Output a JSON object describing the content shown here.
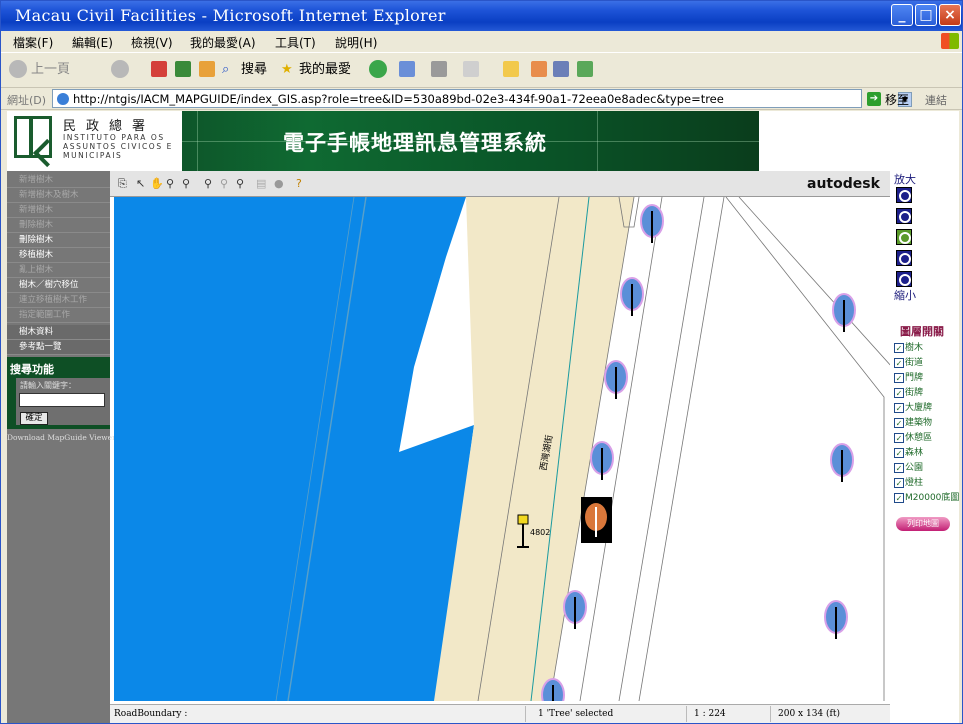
{
  "window": {
    "title": "Macau Civil Facilities - Microsoft Internet Explorer"
  },
  "menubar": {
    "items": [
      "檔案(F)",
      "編輯(E)",
      "檢視(V)",
      "我的最愛(A)",
      "工具(T)",
      "說明(H)"
    ]
  },
  "toolbar": {
    "back": "上一頁",
    "search": "搜尋",
    "favorites": "我的最愛"
  },
  "address": {
    "label": "網址(D)",
    "url": "http://ntgis/IACM_MAPGUIDE/index_GIS.asp?role=tree&ID=530a89bd-02e3-434f-90a1-72eea0e8adec&type=tree",
    "go": "移至",
    "links": "連結"
  },
  "banner": {
    "org_cn": "民政總署",
    "org_pt": "INSTITUTO PARA OS ASSUNTOS CIVICOS E MUNICIPAIS",
    "title": "電子手帳地理訊息管理系統"
  },
  "sidebar": {
    "items": [
      {
        "label": "新增樹木",
        "state": "dim"
      },
      {
        "label": "新增樹木及樹木",
        "state": "dim"
      },
      {
        "label": "新增樹木",
        "state": "dim"
      },
      {
        "label": "刪除樹木",
        "state": "dim"
      },
      {
        "label": "刪除樹木",
        "state": "lit"
      },
      {
        "label": "移植樹木",
        "state": "lit"
      },
      {
        "label": "亂上樹木",
        "state": "dim"
      },
      {
        "label": "樹木／樹穴移位",
        "state": "lit"
      },
      {
        "label": "連立移植樹木工作",
        "state": "dim"
      },
      {
        "label": "指定範圍工作",
        "state": "dim"
      }
    ],
    "secondary": [
      "樹木資料",
      "參考點一覽"
    ],
    "search_title": "搜尋功能",
    "search_label": "請輸入關鍵字：",
    "search_button": "確定",
    "download_link": "Download MapGuide Viewer"
  },
  "map_toolbar": {
    "brand": "autodesk"
  },
  "map": {
    "street_name": "西灣湖街",
    "lamp_number": "4802",
    "colors": {
      "water": "#0b88e8",
      "road": "#f2e8c8",
      "selected": "#000000"
    }
  },
  "statusbar": {
    "layer": "RoadBoundary :",
    "selection": "1 'Tree' selected",
    "scale": "1 : 224",
    "size": "200 x 134 (ft)"
  },
  "rightpanel": {
    "zoom_in": "放大",
    "zoom_out": "縮小",
    "layers_title": "圖層開關",
    "layers": [
      "樹木",
      "街道",
      "門牌",
      "街牌",
      "大廈牌",
      "建築物",
      "休憩區",
      "森林",
      "公園",
      "燈柱",
      "M20000底圖"
    ],
    "pink_button": "列印地圖"
  }
}
